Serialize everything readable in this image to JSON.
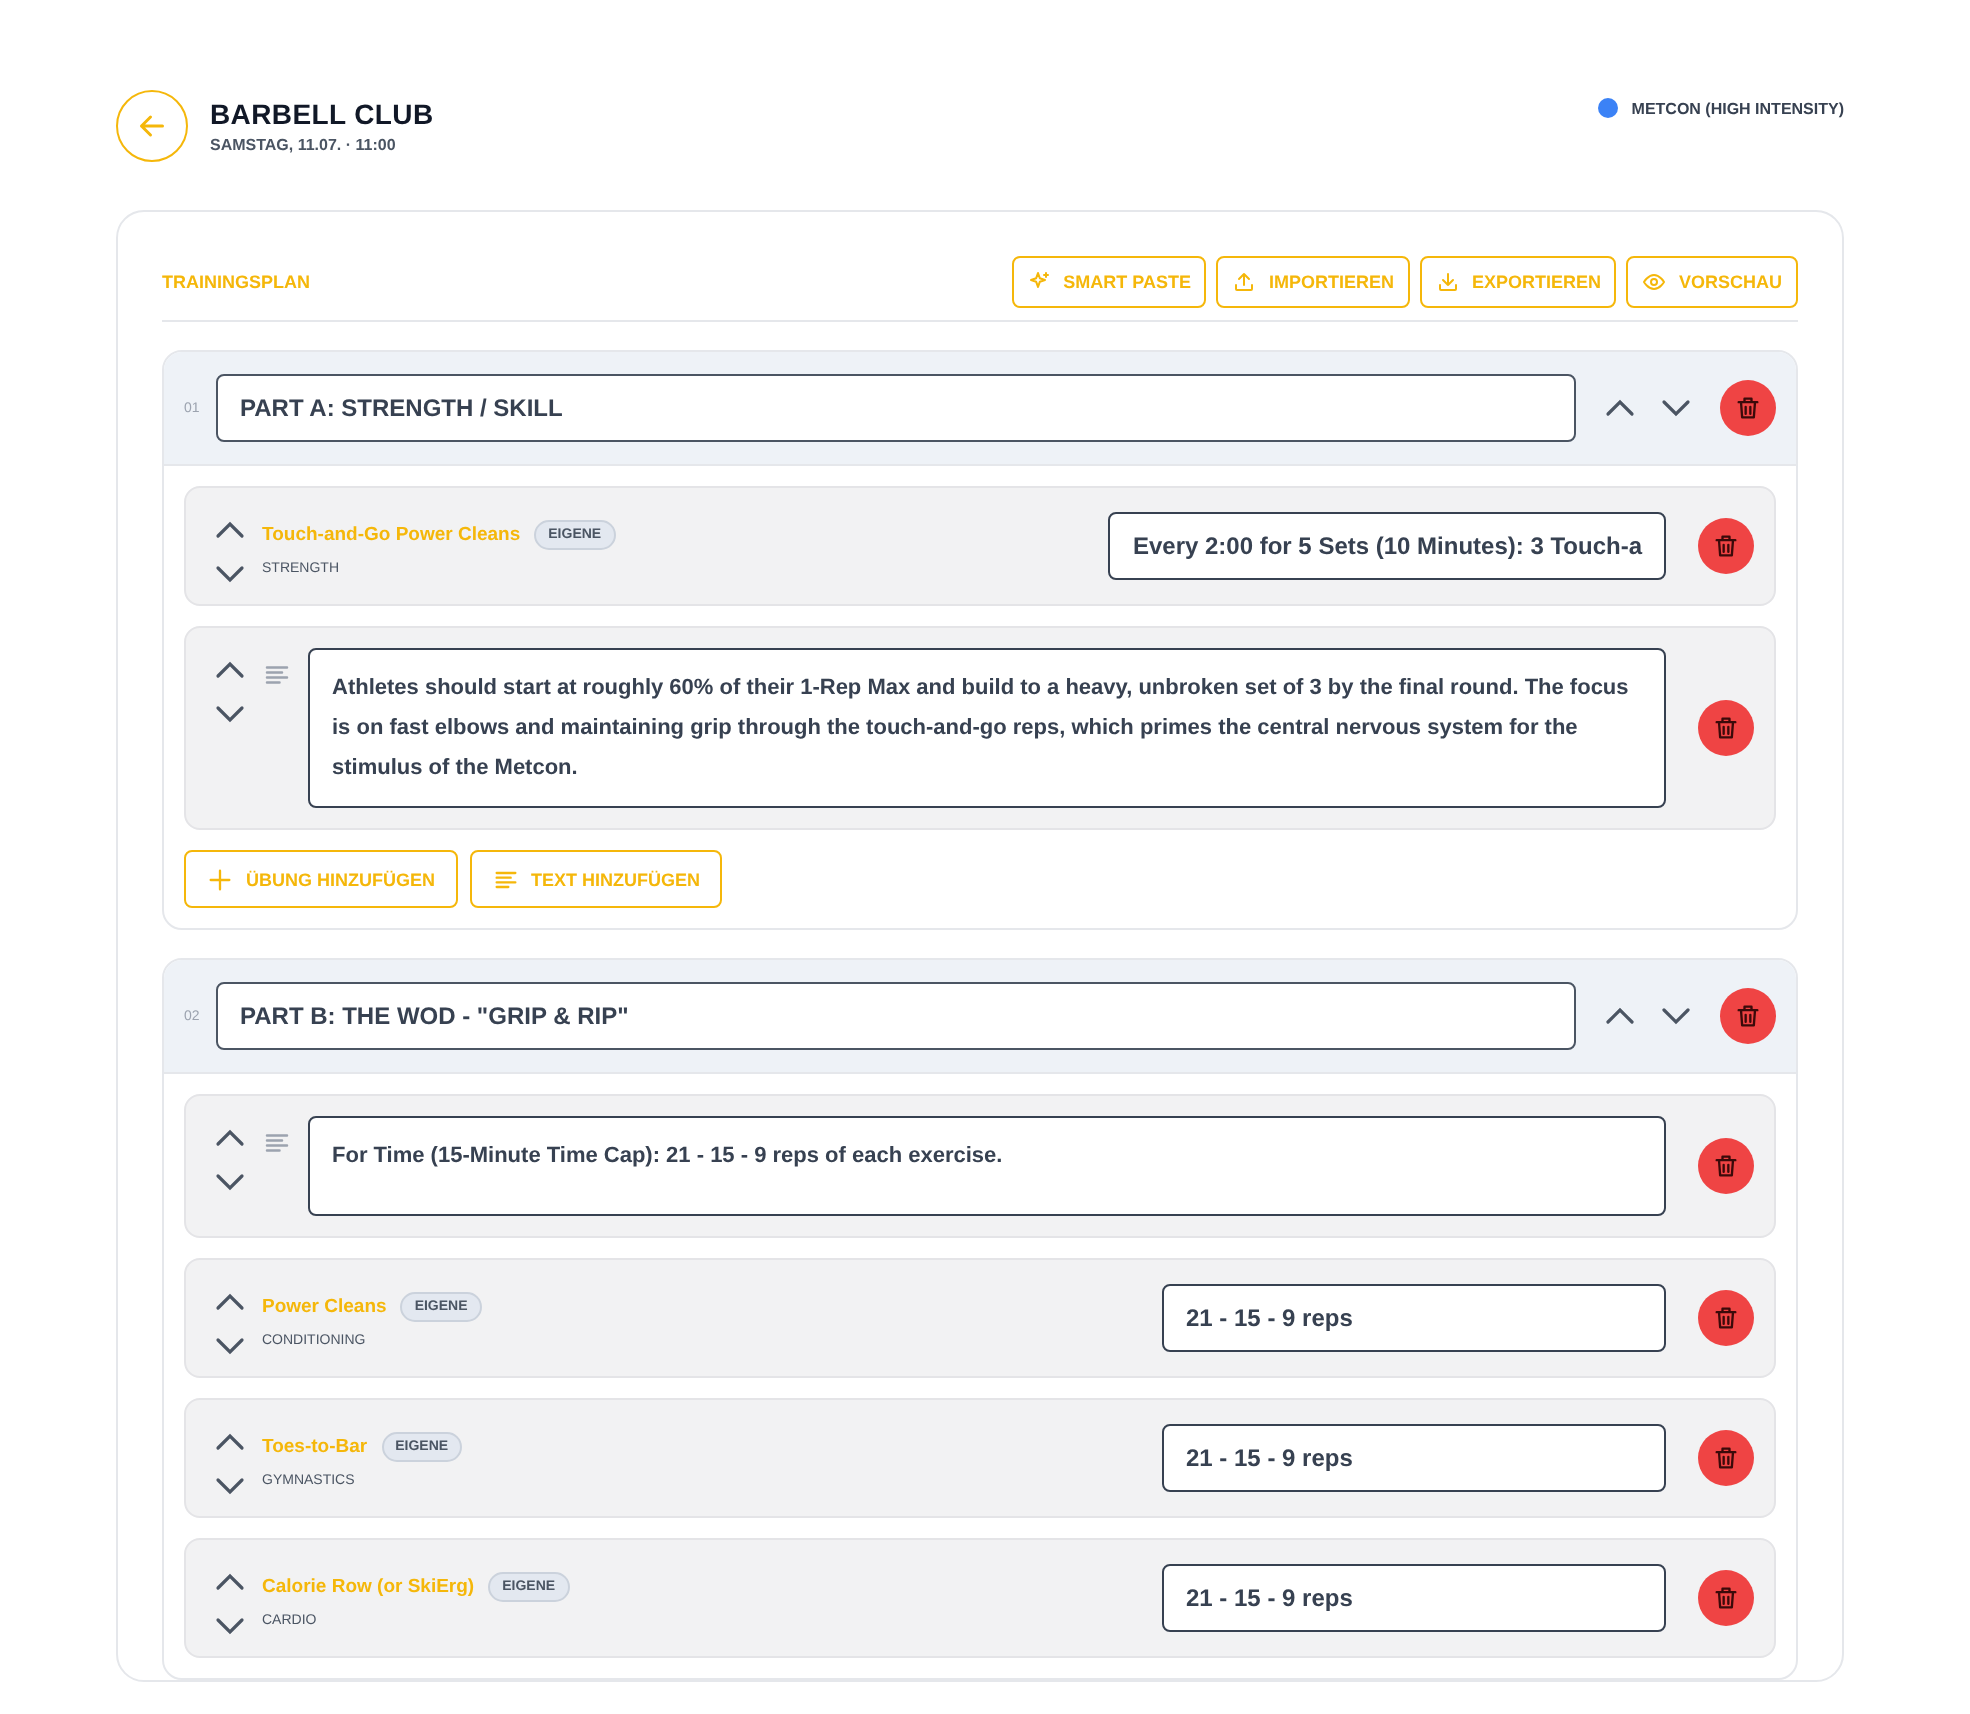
{
  "header": {
    "title": "BARBELL CLUB",
    "subtitle": "SAMSTAG, 11.07. · 11:00",
    "category": {
      "label": "METCON (HIGH INTENSITY)",
      "color": "#3b82f6"
    }
  },
  "plan": {
    "title": "TRAININGSPLAN",
    "actions": [
      {
        "label": "SMART PASTE",
        "kind": "sparkle"
      },
      {
        "label": "IMPORTIEREN",
        "kind": "upload"
      },
      {
        "label": "EXPORTIEREN",
        "kind": "download"
      },
      {
        "label": "VORSCHAU",
        "kind": "eye"
      }
    ]
  },
  "parts": [
    {
      "number": "01",
      "title": "PART A: STRENGTH / SKILL",
      "items": [
        {
          "kind": "exercise",
          "name": "Touch-and-Go Power Cleans",
          "badge": "EIGENE",
          "category": "STRENGTH",
          "value": "Every 2:00 for 5 Sets (10 Minutes): 3 Touch-a"
        },
        {
          "kind": "text",
          "text": "Athletes should start at roughly 60% of their 1-Rep Max and build to a heavy, unbroken set of 3 by the final round. The focus is on fast elbows and maintaining grip through the touch-and-go reps, which primes the central nervous system for the stimulus of the Metcon."
        }
      ],
      "add_buttons": [
        {
          "label": "ÜBUNG HINZUFÜGEN",
          "kind": "plus"
        },
        {
          "label": "TEXT HINZUFÜGEN",
          "kind": "lines"
        }
      ]
    },
    {
      "number": "02",
      "title": "PART B: THE WOD - \"GRIP & RIP\"",
      "items": [
        {
          "kind": "text",
          "text": "For Time (15-Minute Time Cap): 21 - 15 - 9 reps of each exercise."
        },
        {
          "kind": "exercise",
          "name": "Power Cleans",
          "badge": "EIGENE",
          "category": "CONDITIONING",
          "value": "21 - 15 - 9 reps"
        },
        {
          "kind": "exercise",
          "name": "Toes-to-Bar",
          "badge": "EIGENE",
          "category": "GYMNASTICS",
          "value": "21 - 15 - 9 reps"
        },
        {
          "kind": "exercise",
          "name": "Calorie Row (or SkiErg)",
          "badge": "EIGENE",
          "category": "CARDIO",
          "value": "21 - 15 - 9 reps"
        }
      ]
    }
  ]
}
